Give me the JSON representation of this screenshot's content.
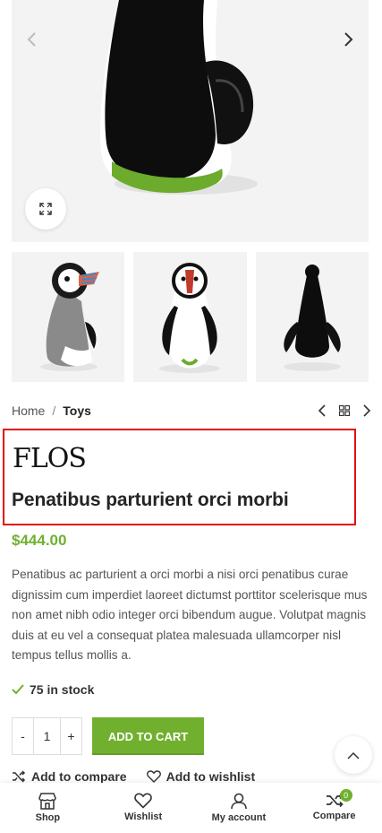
{
  "gallery": {
    "main_image_alt": "",
    "prev_icon": "chevron-left-icon",
    "next_icon": "chevron-right-icon",
    "zoom_icon": "expand-icon",
    "thumbnails": [
      "puffin-grey-figurine",
      "puffin-white-figurine",
      "penguin-black-figurine"
    ]
  },
  "breadcrumb": {
    "home": "Home",
    "separator": "/",
    "current": "Toys"
  },
  "product": {
    "brand": "FLOS",
    "title": "Penatibus parturient orci morbi",
    "price": "$444.00",
    "description": "Penatibus ac parturient a orci morbi a nisi orci penatibus curae dignissim cum imperdiet laoreet dictumst porttitor scelerisque mus non amet nibh odio integer orci bibendum augue. Volutpat magnis duis at eu vel a consequat platea malesuada ullamcorper nisl tempus tellus mollis a.",
    "stock": "75 in stock",
    "quantity": "1",
    "qty_minus": "-",
    "qty_plus": "+",
    "add_to_cart": "ADD TO CART",
    "add_to_compare": "Add to compare",
    "add_to_wishlist": "Add to wishlist"
  },
  "toolbar": {
    "shop": "Shop",
    "wishlist": "Wishlist",
    "account": "My account",
    "compare": "Compare",
    "compare_count": "0"
  },
  "colors": {
    "accent": "#71b02f",
    "highlight_box": "#e01010"
  }
}
